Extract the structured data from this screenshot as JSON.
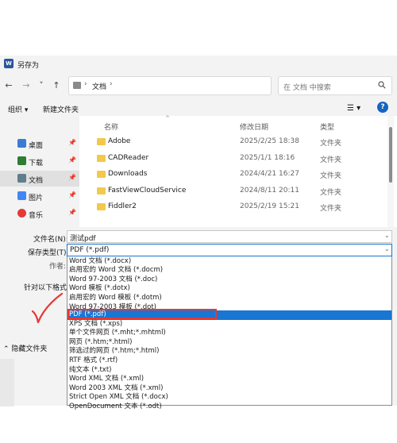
{
  "window": {
    "title": "另存为",
    "app_icon": "W"
  },
  "nav": {
    "back_icon": "←",
    "forward_icon": "→",
    "dropdown_icon": "˅",
    "up_icon": "↑"
  },
  "address": {
    "sep": "›",
    "folder": "文档"
  },
  "search": {
    "placeholder": "在 文档 中搜索"
  },
  "toolbar": {
    "organize": "组织 ▾",
    "new_folder": "新建文件夹",
    "view_icon": "☰ ▾",
    "help": "?"
  },
  "sidebar": {
    "items": [
      {
        "label": "桌面",
        "color": "#3a7bd5"
      },
      {
        "label": "下载",
        "color": "#2e7d32"
      },
      {
        "label": "文档",
        "color": "#607d8b"
      },
      {
        "label": "图片",
        "color": "#4285f4"
      },
      {
        "label": "音乐",
        "color": "#e53935"
      }
    ],
    "pin": "📌"
  },
  "columns": {
    "name": "名称",
    "modified": "修改日期",
    "type": "类型"
  },
  "files": [
    {
      "name": "Adobe",
      "date": "2025/2/25 18:38",
      "type": "文件夹"
    },
    {
      "name": "CADReader",
      "date": "2025/1/1 18:16",
      "type": "文件夹"
    },
    {
      "name": "Downloads",
      "date": "2024/4/21 16:27",
      "type": "文件夹"
    },
    {
      "name": "FastViewCloudService",
      "date": "2024/8/11 20:11",
      "type": "文件夹"
    },
    {
      "name": "Fiddler2",
      "date": "2025/2/19 15:21",
      "type": "文件夹"
    }
  ],
  "form": {
    "filename_label": "文件名(N):",
    "filename_value": "测试pdf",
    "filetype_label": "保存类型(T):",
    "filetype_value": "PDF (*.pdf)",
    "author_label": "作者:",
    "compat_label": "针对以下格式",
    "hide_folders": "⌃ 隐藏文件夹",
    "arrow": "⌄"
  },
  "filetype_options": [
    "Word 文档 (*.docx)",
    "启用宏的 Word 文档 (*.docm)",
    "Word 97-2003 文档 (*.doc)",
    "Word 模板 (*.dotx)",
    "启用宏的 Word 模板 (*.dotm)",
    "Word 97-2003 模板 (*.dot)",
    "PDF (*.pdf)",
    "XPS 文档 (*.xps)",
    "单个文件网页 (*.mht;*.mhtml)",
    "网页 (*.htm;*.html)",
    "筛选过的网页 (*.htm;*.html)",
    "RTF 格式 (*.rtf)",
    "纯文本 (*.txt)",
    "Word XML 文档 (*.xml)",
    "Word 2003 XML 文档 (*.xml)",
    "Strict Open XML 文档 (*.docx)",
    "OpenDocument 文本 (*.odt)"
  ],
  "selected_option_index": 6,
  "colors": {
    "accent": "#1976d2",
    "highlight_box": "#e53935",
    "checkmark": "#e53935"
  }
}
